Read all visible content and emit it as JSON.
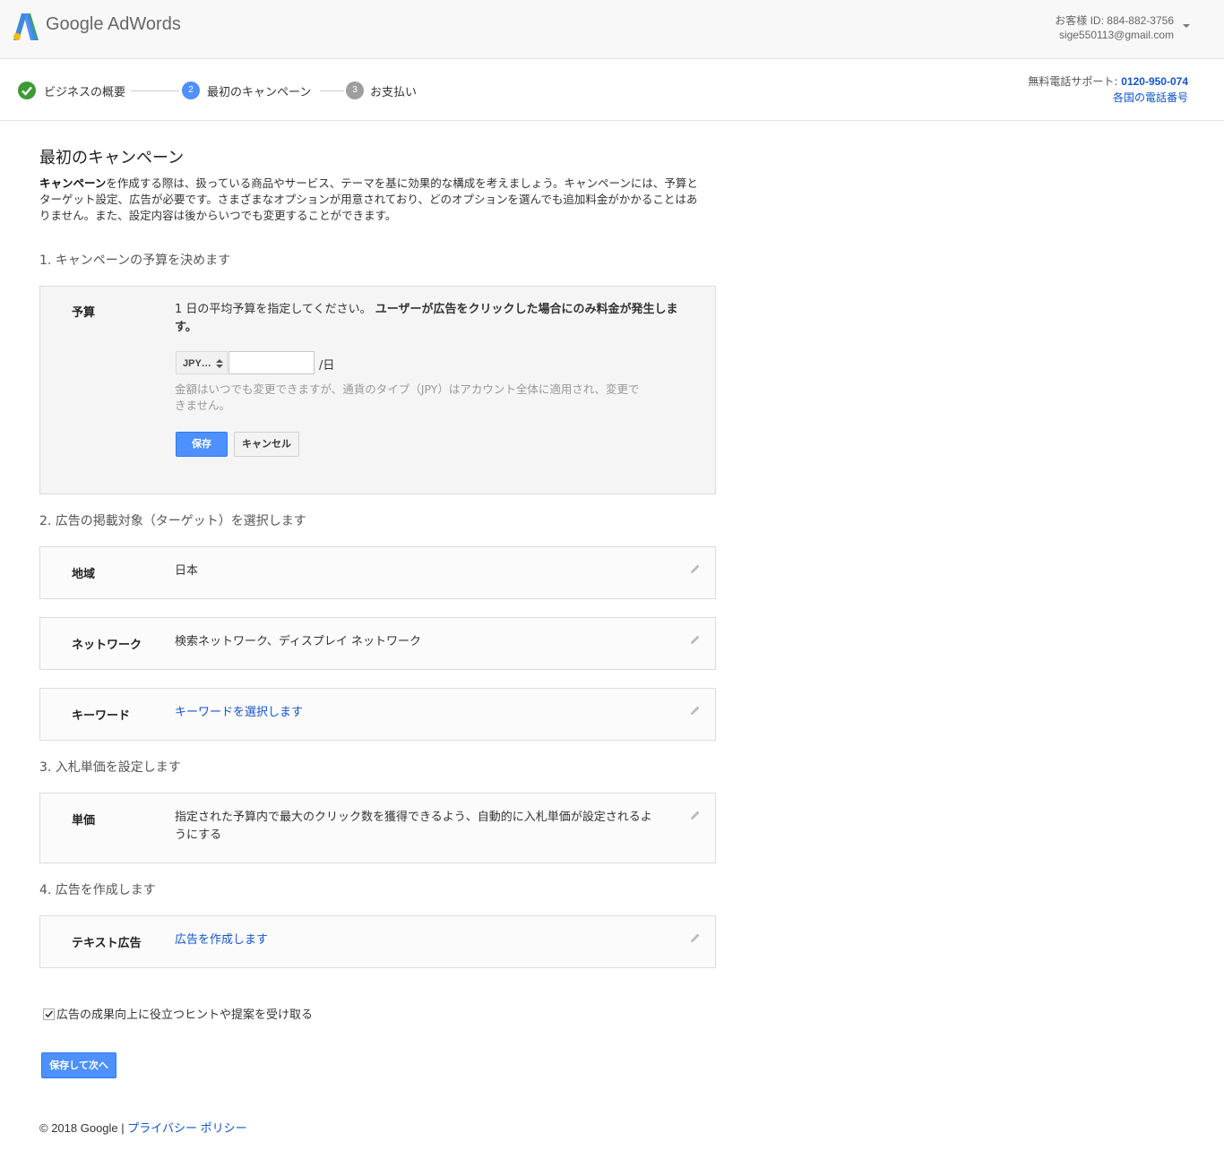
{
  "header": {
    "logo_text": "Google AdWords",
    "customer_id": "お客様 ID: 884-882-3756",
    "email": "sige550113@gmail.com"
  },
  "steps": [
    {
      "number": "",
      "label": "ビジネスの概要",
      "state": "done"
    },
    {
      "number": "2",
      "label": "最初のキャンペーン",
      "state": "current"
    },
    {
      "number": "3",
      "label": "お支払い",
      "state": "pending"
    }
  ],
  "support": {
    "label": "無料電話サポート: ",
    "phone": "0120-950-074",
    "link": "各国の電話番号"
  },
  "page": {
    "title": "最初のキャンペーン",
    "intro_bold": "キャンペーン",
    "intro_rest": "を作成する際は、扱っている商品やサービス、テーマを基に効果的な構成を考えましょう。キャンペーンには、予算とターゲット設定、広告が必要です。さまざまなオプションが用意されており、どのオプションを選んでも追加料金がかかることはありません。また、設定内容は後からいつでも変更することができます。"
  },
  "section1": {
    "title": "1. キャンペーンの予算を決めます",
    "budget_label": "予算",
    "instruction_normal": "1 日の平均予算を指定してください。",
    "instruction_bold": "ユーザーが広告をクリックした場合にのみ料金が発生します。",
    "currency": "JPY…",
    "budget_value": "",
    "per_day": "/日",
    "hint": "金額はいつでも変更できますが、通貨のタイプ（JPY）はアカウント全体に適用され、変更できません。",
    "save_label": "保存",
    "cancel_label": "キャンセル"
  },
  "section2": {
    "title": "2. 広告の掲載対象（ターゲット）を選択します",
    "region_label": "地域",
    "region_value": "日本",
    "network_label": "ネットワーク",
    "network_value": "検索ネットワーク、ディスプレイ ネットワーク",
    "keyword_label": "キーワード",
    "keyword_link": "キーワードを選択します"
  },
  "section3": {
    "title": "3. 入札単価を設定します",
    "price_label": "単価",
    "price_value": "指定された予算内で最大のクリック数を獲得できるよう、自動的に入札単価が設定されるようにする"
  },
  "section4": {
    "title": "4. 広告を作成します",
    "text_ad_label": "テキスト広告",
    "text_ad_link": "広告を作成します"
  },
  "tips_checkbox": {
    "label": "広告の成果向上に役立つヒントや提案を受け取る",
    "checked": true
  },
  "save_next_label": "保存して次へ",
  "footer": {
    "copyright": "© 2018 Google | ",
    "privacy": "プライバシー ポリシー"
  },
  "colors": {
    "accent": "#4d90fe",
    "link": "#1155cc",
    "done_step": "#3d9a35",
    "pending_step": "#9e9e9e"
  }
}
